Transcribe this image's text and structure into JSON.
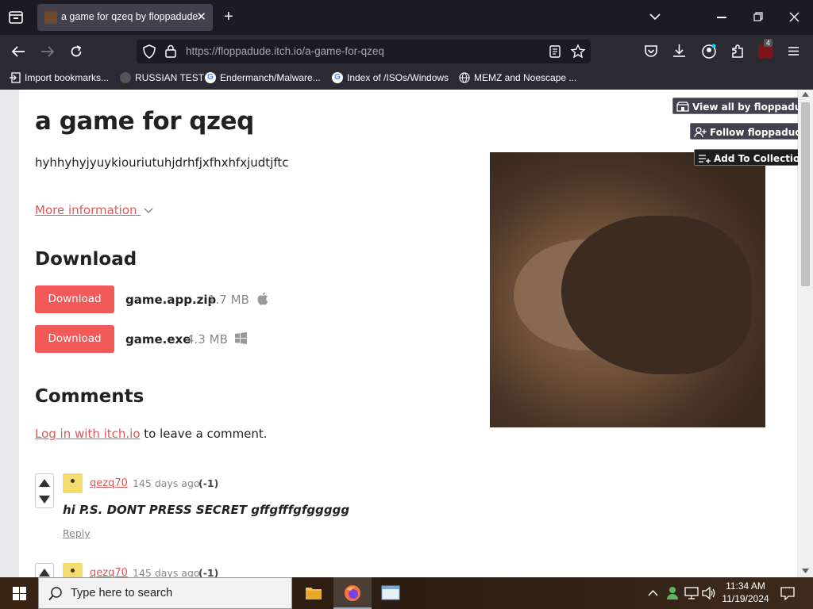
{
  "browser": {
    "tab_title": "a game for qzeq by floppadude",
    "url": "https://floppadude.itch.io/a-game-for-qzeq",
    "extension_badge": "4",
    "bookmarks": [
      {
        "label": "Import bookmarks...",
        "icon": "import-icon"
      },
      {
        "label": "RUSSIAN TEST",
        "icon": "site-favicon"
      },
      {
        "label": "Endermanch/Malware...",
        "icon": "google-icon"
      },
      {
        "label": "Index of /ISOs/Windows",
        "icon": "google-icon"
      },
      {
        "label": "MEMZ and Noescape ...",
        "icon": "globe-icon"
      }
    ]
  },
  "page": {
    "title": "a game for qzeq",
    "description": "hyhhyhyjyuykiouriutuhjdrhfjxfhxhfxjudtjftc",
    "more_info": "More information",
    "download_heading": "Download",
    "downloads": [
      {
        "button": "Download",
        "file": "game.app.zip",
        "size": "1.7 MB",
        "platform": "apple-icon"
      },
      {
        "button": "Download",
        "file": "game.exe",
        "size": "4.3 MB",
        "platform": "windows-icon"
      }
    ],
    "comments_heading": "Comments",
    "login_link": "Log in with itch.io",
    "login_rest": " to leave a comment.",
    "side_buttons": {
      "view_all": "View all by floppadude",
      "follow": "Follow floppadude",
      "collection": "Add To Collection"
    },
    "comments": [
      {
        "user": "qezq70",
        "date": "145 days ago",
        "score": "(-1)",
        "body": "hi P.S. DONT PRESS SECRET gffgfffgfggggg",
        "reply": "Reply"
      },
      {
        "user": "qezq70",
        "date": "145 days ago",
        "score": "(-1)"
      }
    ]
  },
  "taskbar": {
    "search_placeholder": "Type here to search",
    "time": "11:34 AM",
    "date": "11/19/2024"
  },
  "colors": {
    "accent": "#f25a5a",
    "link": "#da5a5a",
    "chrome_bg": "#2b2a33"
  }
}
